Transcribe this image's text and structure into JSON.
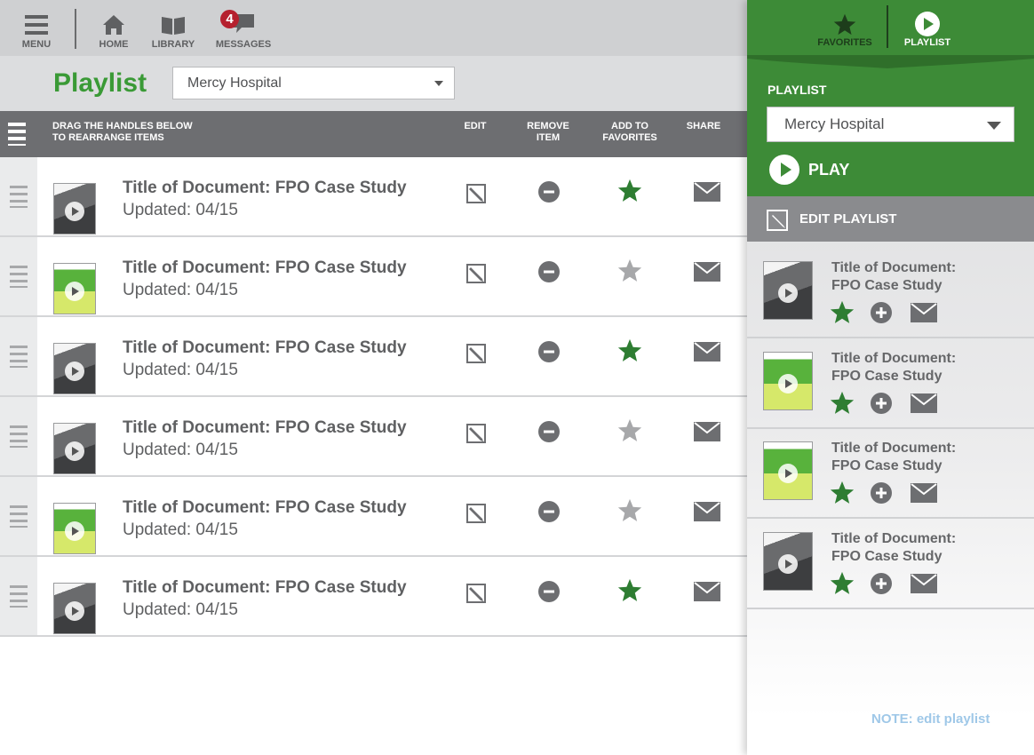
{
  "nav": {
    "menu": "MENU",
    "home": "HOME",
    "library": "LIBRARY",
    "messages": "MESSAGES",
    "messages_badge": "4"
  },
  "header": {
    "title": "Playlist",
    "selected_playlist": "Mercy Hospital"
  },
  "columns": {
    "drag_line1": "DRAG THE HANDLES BELOW",
    "drag_line2": "TO REARRANGE ITEMS",
    "edit": "EDIT",
    "remove_line1": "REMOVE",
    "remove_line2": "ITEM",
    "fav_line1": "ADD TO",
    "fav_line2": "FAVORITES",
    "share": "SHARE"
  },
  "rows": [
    {
      "title": "Title of Document: FPO Case Study",
      "updated": "Updated: 04/15",
      "thumb": "dark",
      "favorited": true
    },
    {
      "title": "Title of Document: FPO Case Study",
      "updated": "Updated: 04/15",
      "thumb": "green",
      "favorited": false
    },
    {
      "title": "Title of Document: FPO Case Study",
      "updated": "Updated: 04/15",
      "thumb": "dark",
      "favorited": true
    },
    {
      "title": "Title of Document: FPO Case Study",
      "updated": "Updated: 04/15",
      "thumb": "dark",
      "favorited": false
    },
    {
      "title": "Title of Document: FPO Case Study",
      "updated": "Updated: 04/15",
      "thumb": "green",
      "favorited": false
    },
    {
      "title": "Title of Document: FPO Case Study",
      "updated": "Updated: 04/15",
      "thumb": "dark",
      "favorited": true
    }
  ],
  "panel": {
    "tab_favorites": "FAVORITES",
    "tab_playlist": "PLAYLIST",
    "playlist_label": "PLAYLIST",
    "playlist_value": "Mercy Hospital",
    "play_label": "PLAY",
    "edit_playlist": "EDIT PLAYLIST",
    "items": [
      {
        "line1": "Title of Document:",
        "line2": "FPO Case Study",
        "thumb": "dark"
      },
      {
        "line1": "Title of Document:",
        "line2": "FPO Case Study",
        "thumb": "green"
      },
      {
        "line1": "Title of Document:",
        "line2": "FPO Case Study",
        "thumb": "green"
      },
      {
        "line1": "Title of Document:",
        "line2": "FPO Case Study",
        "thumb": "dark"
      }
    ]
  },
  "note": "NOTE: edit playlist",
  "colors": {
    "brand_green": "#3d8b37",
    "title_green": "#3a9a36",
    "star_active": "#2e7d32",
    "star_inactive": "#a7a8aa",
    "badge_red": "#b5202e",
    "note_blue": "#9fc8e8"
  }
}
